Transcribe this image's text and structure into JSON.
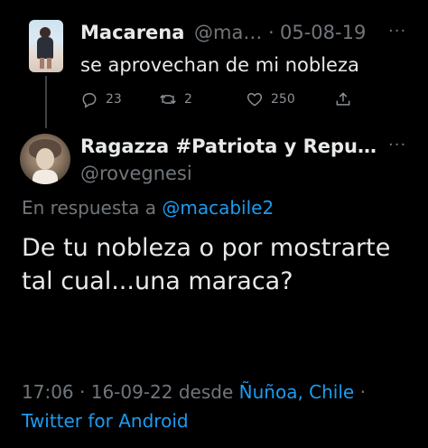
{
  "parent_tweet": {
    "display_name": "Macarena",
    "handle": "@ma…",
    "separator": "·",
    "date": "05-08-19",
    "more": "···",
    "text": "se aprovechan de mi nobleza",
    "reply_count": "23",
    "retweet_count": "2",
    "like_count": "250"
  },
  "main_tweet": {
    "display_name": "Ragazza #Patriota y Repu…",
    "handle": "@rovegnesi",
    "more": "···",
    "reply_prefix": "En respuesta a ",
    "reply_mention": "@macabile2",
    "text": "De tu nobleza o por mostrarte tal cual...una maraca?",
    "time": "17:06",
    "sep1": " · ",
    "date": "16-09-22",
    "location_prefix": " desde ",
    "location": "Ñuñoa, Chile",
    "sep2": " · ",
    "source": "Twitter for Android"
  },
  "icons": {
    "reply": "reply-icon",
    "retweet": "retweet-icon",
    "like": "heart-icon",
    "share": "share-icon"
  },
  "colors": {
    "background": "#000000",
    "primary_text": "#e7e9ea",
    "secondary_text": "#71767b",
    "link": "#1d9bf0"
  }
}
